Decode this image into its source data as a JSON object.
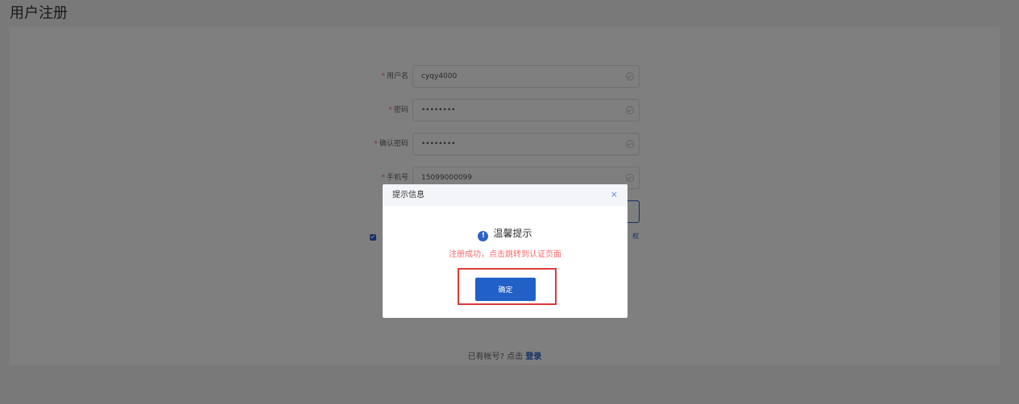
{
  "page": {
    "title": "用户注册"
  },
  "form": {
    "fields": [
      {
        "label": "用户名",
        "value": "cyqy4000"
      },
      {
        "label": "密码",
        "value": "••••••••"
      },
      {
        "label": "确认密码",
        "value": "••••••••"
      },
      {
        "label": "手机号",
        "value": "15099000099"
      }
    ],
    "required_mark": "*",
    "agreement_tail": "权"
  },
  "footer": {
    "prompt": "已有帐号? 点击 ",
    "login_link": "登录"
  },
  "dialog": {
    "title": "提示信息",
    "close": "×",
    "notice_icon": "!",
    "notice_title": "温馨提示",
    "message": "注册成功，点击跳转到认证页面",
    "confirm_label": "确定"
  },
  "colors": {
    "primary": "#2160c6",
    "error": "#f56c6c",
    "highlight_border": "#d93a3a"
  }
}
